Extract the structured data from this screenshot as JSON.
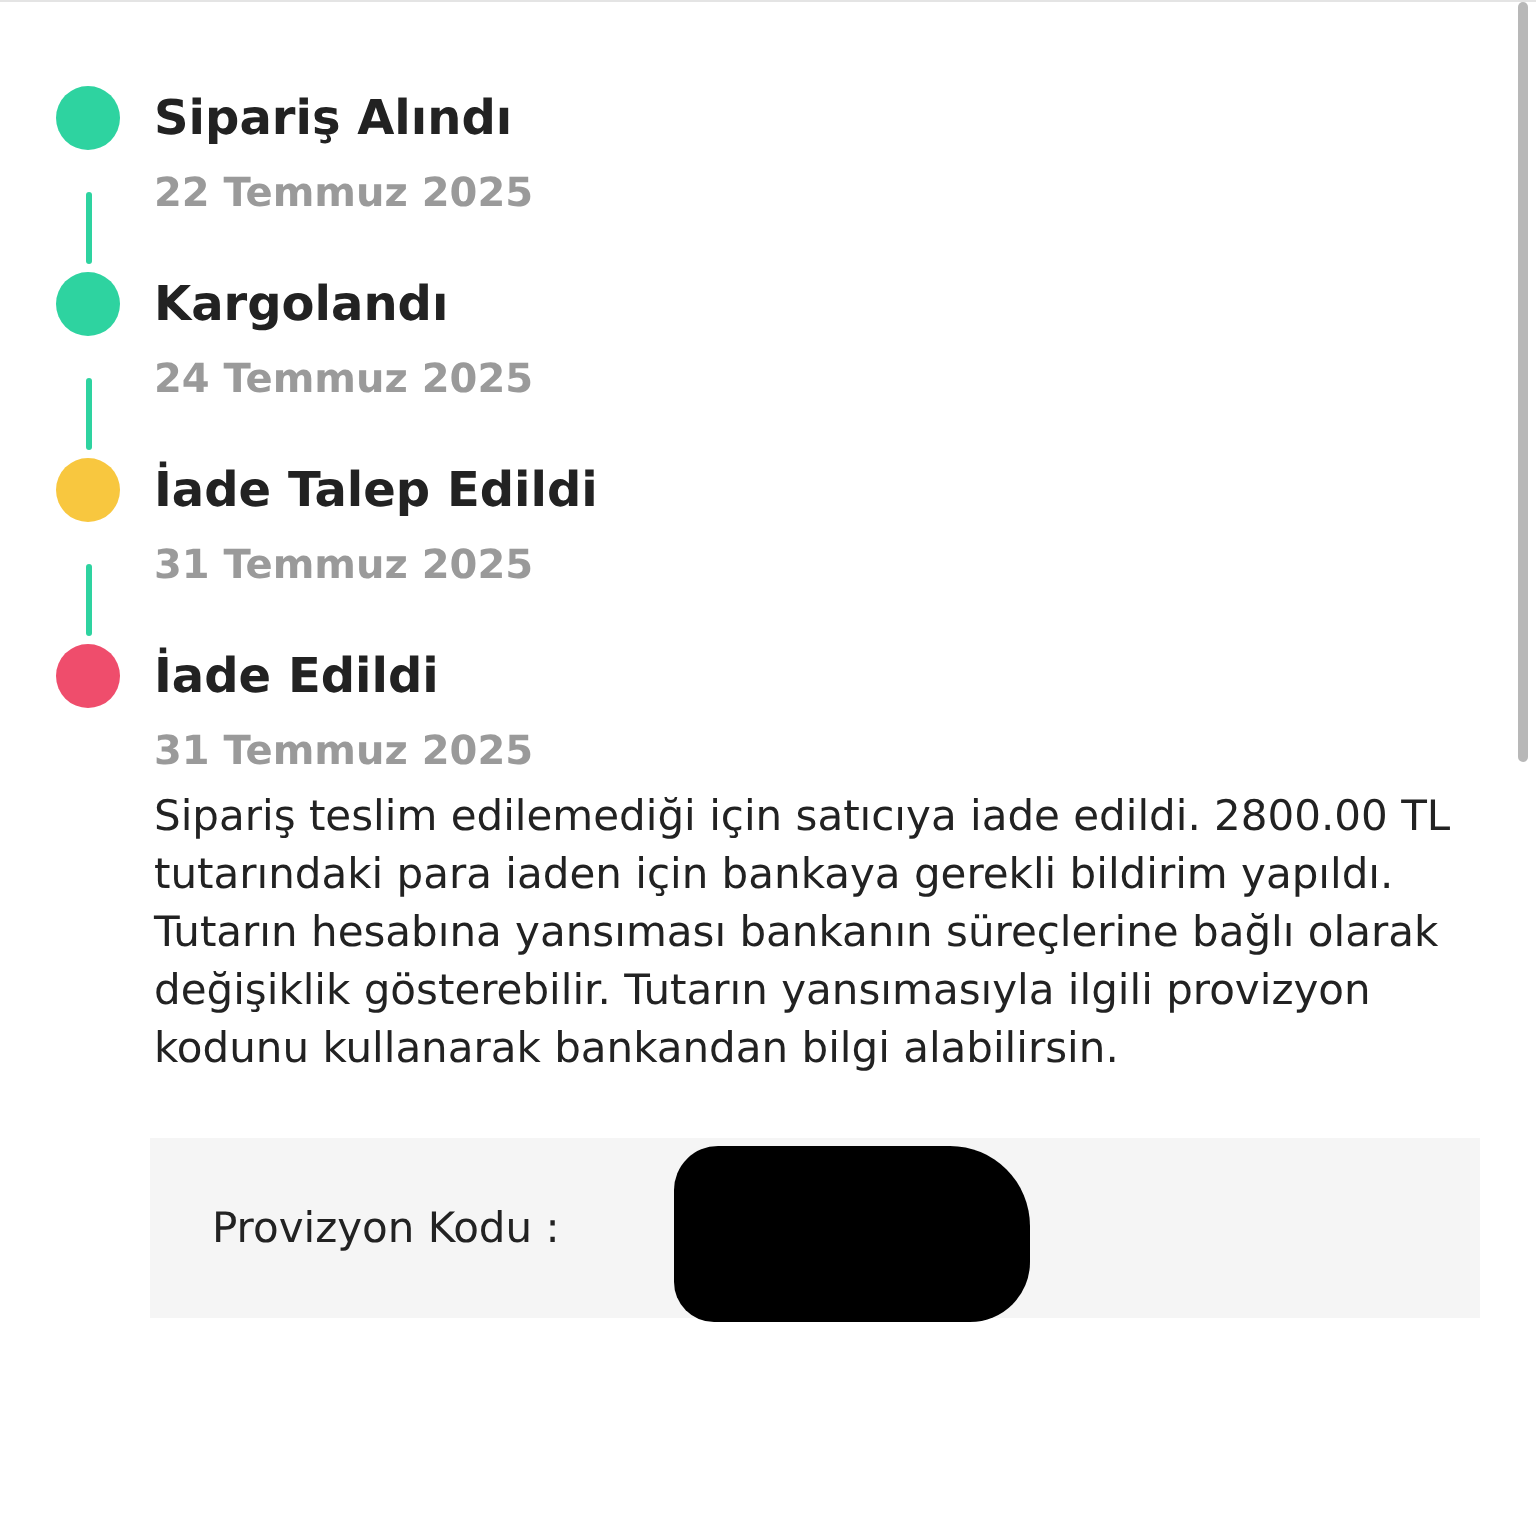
{
  "timeline": [
    {
      "title": "Sipariş Alındı",
      "date": "22 Temmuz 2025",
      "color": "#2ed3a0"
    },
    {
      "title": "Kargolandı",
      "date": "24 Temmuz 2025",
      "color": "#2ed3a0"
    },
    {
      "title": "İade Talep Edildi",
      "date": "31 Temmuz 2025",
      "color": "#f8c73f"
    },
    {
      "title": "İade Edildi",
      "date": "31 Temmuz 2025",
      "color": "#ef4d6c"
    }
  ],
  "message": "Sipariş teslim edilemediği için satıcıya iade edildi. 2800.00 TL tutarındaki para iaden için bankaya gerekli bildirim yapıldı. Tutarın hesabına yansıması bankanın süreçlerine bağlı olarak değişiklik gösterebilir. Tutarın yansımasıyla ilgili provizyon kodunu kullanarak bankandan bilgi alabilirsin.",
  "provision": {
    "label": "Provizyon Kodu :"
  }
}
